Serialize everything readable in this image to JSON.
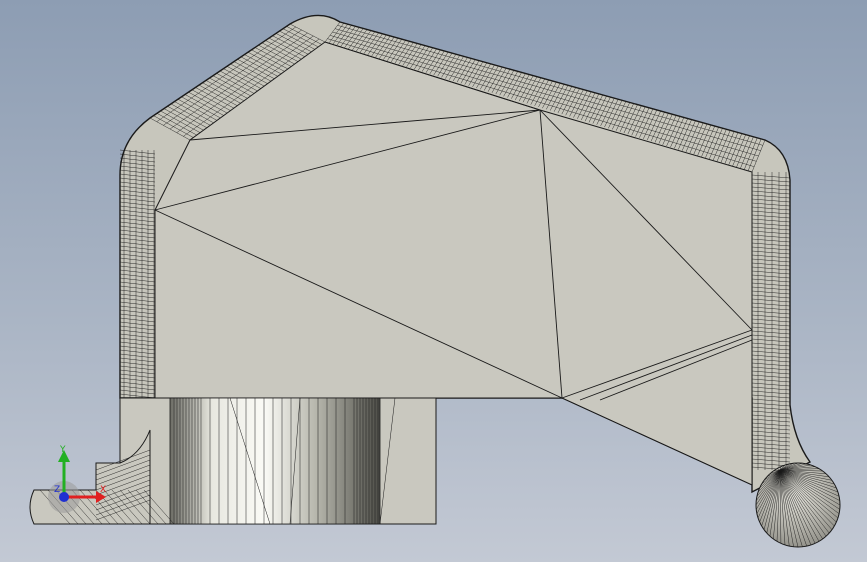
{
  "viewport": {
    "background_top": "#8d9db3",
    "background_bottom": "#c3c9d4",
    "model": {
      "face_color": "#c7c6bc",
      "edge_color": "#1a1a1a",
      "render_mode": "shaded-with-mesh-edges"
    },
    "triad": {
      "x_label": "X",
      "y_label": "Y",
      "z_label": "Z",
      "x_color": "#e02020",
      "y_color": "#22b022",
      "z_color": "#2030d0"
    }
  }
}
